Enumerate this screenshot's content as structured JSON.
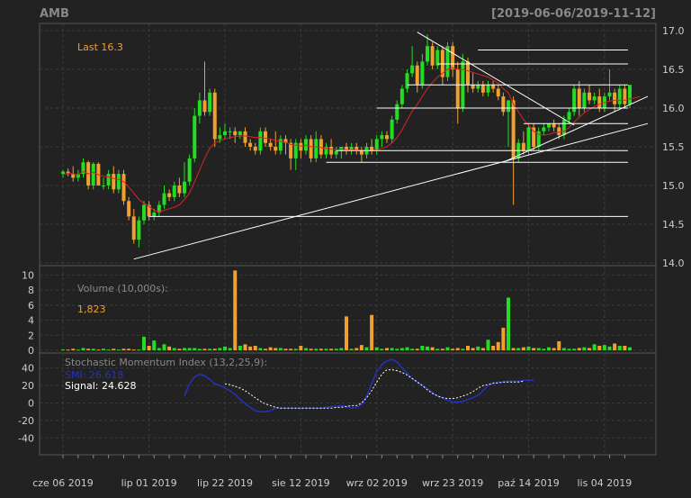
{
  "chart_data": {
    "type": "candlestick",
    "symbol": "AMB",
    "date_range": "[2019-06-06/2019-11-12]",
    "last_label": "Last 16.3",
    "colors": {
      "background": "#222222",
      "panel_border": "#555555",
      "grid": "#3c3c3c",
      "up": "#22dd22",
      "down": "#f0a030",
      "ma_line": "#dd2222",
      "smi_line": "#2233bb",
      "signal_line": "#ffffff",
      "title_text": "#888888",
      "last_text": "#f0a030",
      "axis_text": "#cccccc"
    },
    "x_ticks": [
      "cze 06 2019",
      "lip 01 2019",
      "lip 22 2019",
      "sie 12 2019",
      "wrz 02 2019",
      "wrz 23 2019",
      "paź 14 2019",
      "lis 04 2019"
    ],
    "x_tick_index": [
      0,
      17,
      32,
      47,
      62,
      77,
      92,
      107
    ],
    "price": {
      "ylim": [
        14.0,
        17.0
      ],
      "yticks": [
        "14.0",
        "14.5",
        "15.0",
        "15.5",
        "16.0",
        "16.5",
        "17.0"
      ],
      "candles": [
        [
          15.15,
          15.2,
          15.1,
          15.18
        ],
        [
          15.18,
          15.22,
          15.12,
          15.15
        ],
        [
          15.15,
          15.25,
          15.05,
          15.1
        ],
        [
          15.1,
          15.2,
          15.05,
          15.15
        ],
        [
          15.15,
          15.35,
          15.1,
          15.3
        ],
        [
          15.3,
          15.32,
          14.95,
          15.0
        ],
        [
          15.0,
          15.3,
          14.95,
          15.28
        ],
        [
          15.28,
          15.3,
          15.05,
          15.0
        ],
        [
          15.0,
          15.1,
          14.95,
          15.0
        ],
        [
          15.0,
          15.2,
          14.95,
          15.15
        ],
        [
          15.15,
          15.25,
          14.9,
          14.95
        ],
        [
          14.95,
          15.2,
          14.9,
          15.15
        ],
        [
          15.15,
          15.2,
          14.75,
          14.8
        ],
        [
          14.8,
          14.85,
          14.55,
          14.6
        ],
        [
          14.6,
          14.7,
          14.25,
          14.3
        ],
        [
          14.3,
          14.6,
          14.2,
          14.55
        ],
        [
          14.55,
          14.8,
          14.5,
          14.75
        ],
        [
          14.75,
          14.8,
          14.55,
          14.6
        ],
        [
          14.6,
          14.7,
          14.55,
          14.65
        ],
        [
          14.65,
          14.8,
          14.6,
          14.75
        ],
        [
          14.75,
          15.0,
          14.7,
          14.9
        ],
        [
          14.9,
          14.95,
          14.8,
          14.85
        ],
        [
          14.85,
          15.05,
          14.8,
          15.0
        ],
        [
          15.0,
          15.1,
          14.85,
          14.9
        ],
        [
          14.9,
          15.3,
          14.85,
          15.05
        ],
        [
          15.05,
          15.4,
          15.0,
          15.35
        ],
        [
          15.35,
          16.0,
          15.3,
          15.9
        ],
        [
          15.9,
          16.2,
          15.8,
          16.1
        ],
        [
          16.1,
          16.6,
          15.9,
          15.95
        ],
        [
          15.95,
          16.25,
          15.9,
          16.2
        ],
        [
          16.2,
          16.25,
          15.5,
          15.6
        ],
        [
          15.6,
          15.75,
          15.55,
          15.65
        ],
        [
          15.65,
          15.8,
          15.6,
          15.7
        ],
        [
          15.7,
          15.75,
          15.6,
          15.7
        ],
        [
          15.7,
          15.75,
          15.55,
          15.65
        ],
        [
          15.65,
          15.7,
          15.6,
          15.7
        ],
        [
          15.7,
          15.75,
          15.5,
          15.55
        ],
        [
          15.55,
          15.6,
          15.45,
          15.5
        ],
        [
          15.5,
          15.55,
          15.4,
          15.45
        ],
        [
          15.45,
          15.75,
          15.4,
          15.7
        ],
        [
          15.7,
          15.75,
          15.5,
          15.55
        ],
        [
          15.55,
          15.6,
          15.45,
          15.5
        ],
        [
          15.5,
          15.7,
          15.4,
          15.45
        ],
        [
          15.45,
          15.65,
          15.4,
          15.6
        ],
        [
          15.6,
          15.65,
          15.4,
          15.55
        ],
        [
          15.55,
          15.6,
          15.2,
          15.35
        ],
        [
          15.35,
          15.6,
          15.2,
          15.55
        ],
        [
          15.55,
          15.6,
          15.35,
          15.45
        ],
        [
          15.45,
          15.65,
          15.4,
          15.6
        ],
        [
          15.6,
          15.65,
          15.3,
          15.35
        ],
        [
          15.35,
          15.7,
          15.3,
          15.6
        ],
        [
          15.6,
          15.65,
          15.35,
          15.4
        ],
        [
          15.4,
          15.55,
          15.35,
          15.5
        ],
        [
          15.5,
          15.6,
          15.35,
          15.4
        ],
        [
          15.4,
          15.5,
          15.35,
          15.45
        ],
        [
          15.45,
          15.5,
          15.35,
          15.5
        ],
        [
          15.5,
          15.55,
          15.4,
          15.45
        ],
        [
          15.45,
          15.55,
          15.4,
          15.5
        ],
        [
          15.5,
          15.55,
          15.4,
          15.45
        ],
        [
          15.45,
          15.5,
          15.3,
          15.4
        ],
        [
          15.4,
          15.55,
          15.35,
          15.5
        ],
        [
          15.5,
          15.6,
          15.4,
          15.45
        ],
        [
          15.45,
          15.65,
          15.4,
          15.6
        ],
        [
          15.6,
          15.7,
          15.5,
          15.65
        ],
        [
          15.65,
          15.7,
          15.55,
          15.6
        ],
        [
          15.6,
          15.9,
          15.55,
          15.85
        ],
        [
          15.85,
          16.1,
          15.8,
          16.05
        ],
        [
          16.05,
          16.3,
          16.0,
          16.25
        ],
        [
          16.25,
          16.5,
          16.2,
          16.45
        ],
        [
          16.45,
          16.8,
          16.4,
          16.55
        ],
        [
          16.55,
          16.6,
          16.2,
          16.3
        ],
        [
          16.3,
          16.7,
          16.25,
          16.6
        ],
        [
          16.6,
          16.95,
          16.55,
          16.8
        ],
        [
          16.8,
          16.85,
          16.5,
          16.55
        ],
        [
          16.55,
          16.8,
          16.5,
          16.75
        ],
        [
          16.75,
          16.8,
          16.3,
          16.4
        ],
        [
          16.4,
          16.85,
          16.35,
          16.8
        ],
        [
          16.8,
          16.85,
          16.4,
          16.5
        ],
        [
          16.5,
          16.6,
          15.8,
          16.0
        ],
        [
          16.0,
          16.7,
          15.95,
          16.6
        ],
        [
          16.6,
          16.65,
          16.2,
          16.3
        ],
        [
          16.3,
          16.45,
          16.2,
          16.25
        ],
        [
          16.25,
          16.35,
          16.2,
          16.3
        ],
        [
          16.3,
          16.35,
          16.15,
          16.2
        ],
        [
          16.2,
          16.35,
          16.15,
          16.3
        ],
        [
          16.3,
          16.35,
          16.2,
          16.25
        ],
        [
          16.25,
          16.3,
          16.1,
          16.15
        ],
        [
          16.15,
          16.2,
          15.9,
          15.95
        ],
        [
          15.95,
          16.1,
          15.5,
          16.1
        ],
        [
          16.1,
          16.15,
          14.75,
          15.35
        ],
        [
          15.35,
          15.6,
          15.3,
          15.55
        ],
        [
          15.55,
          15.7,
          15.4,
          15.45
        ],
        [
          15.45,
          15.8,
          15.4,
          15.75
        ],
        [
          15.75,
          15.8,
          15.45,
          15.5
        ],
        [
          15.5,
          15.75,
          15.45,
          15.7
        ],
        [
          15.7,
          15.8,
          15.65,
          15.75
        ],
        [
          15.75,
          15.8,
          15.7,
          15.8
        ],
        [
          15.8,
          15.85,
          15.7,
          15.75
        ],
        [
          15.75,
          15.8,
          15.6,
          15.65
        ],
        [
          15.65,
          15.9,
          15.6,
          15.85
        ],
        [
          15.85,
          16.0,
          15.8,
          15.95
        ],
        [
          15.95,
          16.3,
          15.9,
          16.25
        ],
        [
          16.25,
          16.35,
          15.9,
          16.0
        ],
        [
          16.0,
          16.25,
          15.95,
          16.2
        ],
        [
          16.2,
          16.3,
          16.05,
          16.1
        ],
        [
          16.1,
          16.2,
          16.05,
          16.15
        ],
        [
          16.15,
          16.25,
          15.95,
          16.0
        ],
        [
          16.0,
          16.2,
          15.95,
          16.15
        ],
        [
          16.15,
          16.5,
          16.1,
          16.2
        ],
        [
          16.2,
          16.25,
          15.95,
          16.05
        ],
        [
          16.05,
          16.3,
          16.0,
          16.25
        ],
        [
          16.25,
          16.3,
          16.0,
          16.05
        ],
        [
          16.05,
          16.3,
          16.0,
          16.3
        ]
      ],
      "ma": [
        15.14,
        15.16,
        15.15,
        15.14,
        15.18,
        15.15,
        15.17,
        15.14,
        15.12,
        15.11,
        15.09,
        15.08,
        15.05,
        14.98,
        14.9,
        14.82,
        14.77,
        14.73,
        14.68,
        14.66,
        14.68,
        14.7,
        14.72,
        14.75,
        14.82,
        14.9,
        15.05,
        15.2,
        15.35,
        15.48,
        15.55,
        15.58,
        15.6,
        15.62,
        15.63,
        15.64,
        15.64,
        15.63,
        15.62,
        15.62,
        15.61,
        15.6,
        15.58,
        15.57,
        15.56,
        15.53,
        15.52,
        15.51,
        15.52,
        15.5,
        15.5,
        15.49,
        15.48,
        15.47,
        15.47,
        15.47,
        15.46,
        15.46,
        15.46,
        15.45,
        15.45,
        15.45,
        15.46,
        15.48,
        15.5,
        15.55,
        15.62,
        15.72,
        15.84,
        15.96,
        16.05,
        16.15,
        16.25,
        16.33,
        16.4,
        16.45,
        16.5,
        16.52,
        16.5,
        16.5,
        16.48,
        16.46,
        16.44,
        16.42,
        16.4,
        16.36,
        16.32,
        16.25,
        16.2,
        16.05,
        15.95,
        15.85,
        15.78,
        15.7,
        15.66,
        15.65,
        15.66,
        15.68,
        15.69,
        15.7,
        15.75,
        15.82,
        15.88,
        15.94,
        15.98,
        16.02,
        16.05,
        16.07,
        16.09,
        16.1,
        16.1,
        16.1,
        16.12,
        16.13,
        16.15
      ],
      "h_levels": [
        [
          111,
          16.75
        ],
        [
          109,
          16.57
        ],
        [
          114,
          16.3
        ],
        [
          98,
          16.0
        ],
        [
          112,
          15.8
        ],
        [
          134,
          15.45
        ],
        [
          109,
          15.3
        ],
        [
          161,
          14.6
        ]
      ],
      "trend_lines": [
        {
          "from": [
            70,
            16.98
          ],
          "to": [
            101,
            15.78
          ]
        },
        {
          "from": [
            14,
            14.05
          ],
          "to": [
            115,
            15.8
          ]
        },
        {
          "from": [
            87,
            15.3
          ],
          "to": [
            115,
            16.15
          ]
        }
      ]
    },
    "volume": {
      "title": "Volume (10,000s):",
      "value_label": "1,823",
      "ylim": [
        0,
        11
      ],
      "yticks": [
        "0",
        "2",
        "4",
        "6",
        "8",
        "10"
      ],
      "values": [
        0.1,
        0.1,
        0.2,
        0.1,
        0.3,
        0.2,
        0.2,
        0.1,
        0.2,
        0.1,
        0.2,
        0.1,
        0.2,
        0.2,
        0.1,
        0.1,
        1.8,
        0.6,
        1.3,
        0.3,
        0.8,
        0.5,
        0.3,
        0.2,
        0.3,
        0.3,
        0.3,
        0.2,
        0.2,
        0.2,
        0.2,
        0.3,
        0.5,
        0.3,
        10.6,
        0.6,
        0.8,
        0.5,
        0.6,
        0.3,
        0.2,
        0.4,
        0.3,
        0.3,
        0.2,
        0.2,
        0.2,
        0.6,
        0.3,
        0.2,
        0.2,
        0.2,
        0.2,
        0.2,
        0.2,
        0.3,
        4.5,
        0.2,
        0.3,
        0.7,
        0.4,
        4.7,
        0.4,
        0.2,
        0.3,
        0.3,
        0.2,
        0.3,
        0.4,
        0.2,
        0.2,
        0.6,
        0.5,
        0.4,
        0.2,
        0.2,
        0.4,
        0.2,
        0.3,
        0.2,
        0.6,
        0.3,
        0.5,
        0.3,
        1.4,
        0.6,
        1.1,
        3.0,
        7.0,
        0.3,
        0.3,
        0.4,
        0.5,
        0.3,
        0.3,
        0.2,
        0.4,
        0.3,
        1.2,
        0.3,
        0.2,
        0.2,
        0.3,
        0.4,
        0.3,
        0.8,
        0.6,
        0.7,
        0.5,
        0.9,
        0.6,
        0.6,
        0.4,
        0.9,
        0.5,
        0.6,
        0.7,
        0.6,
        1.5,
        0.3,
        0.2
      ],
      "up_down": []
    },
    "smi": {
      "title": "Stochastic Momentum Index (13,2,25,9):",
      "smi_label": "SMI: 26.618",
      "signal_label": "Signal: 24.628",
      "ylim": [
        -50,
        50
      ],
      "yticks": [
        "-40",
        "-20",
        "0",
        "20",
        "40"
      ],
      "start_index": 24,
      "smi": [
        8,
        22,
        30,
        33,
        31,
        27,
        22,
        20,
        17,
        14,
        10,
        4,
        -1,
        -5,
        -9,
        -10,
        -10,
        -9,
        -6,
        -6,
        -6,
        -6,
        -6,
        -6,
        -6,
        -6,
        -6,
        -6,
        -5,
        -4,
        -4,
        -3,
        -4,
        -6,
        -5,
        -2,
        8,
        22,
        36,
        44,
        48,
        50,
        47,
        40,
        34,
        28,
        24,
        20,
        16,
        12,
        8,
        6,
        3,
        1,
        1,
        2,
        4,
        6,
        9,
        14,
        20,
        22,
        24,
        24,
        25,
        25,
        25,
        26,
        26,
        26
      ],
      "signal": [
        null,
        null,
        null,
        null,
        null,
        null,
        null,
        null,
        22,
        21,
        19,
        17,
        14,
        10,
        6,
        2,
        -1,
        -3,
        -5,
        -6,
        -6,
        -6,
        -6,
        -6,
        -6,
        -6,
        -6,
        -6,
        -6,
        -6,
        -5,
        -5,
        -4,
        -3,
        -3,
        0,
        6,
        14,
        24,
        33,
        38,
        38,
        37,
        35,
        32,
        28,
        24,
        20,
        15,
        11,
        8,
        6,
        5,
        5,
        6,
        8,
        10,
        13,
        17,
        20,
        21,
        23,
        23,
        24,
        24,
        24,
        24,
        25
      ]
    }
  }
}
